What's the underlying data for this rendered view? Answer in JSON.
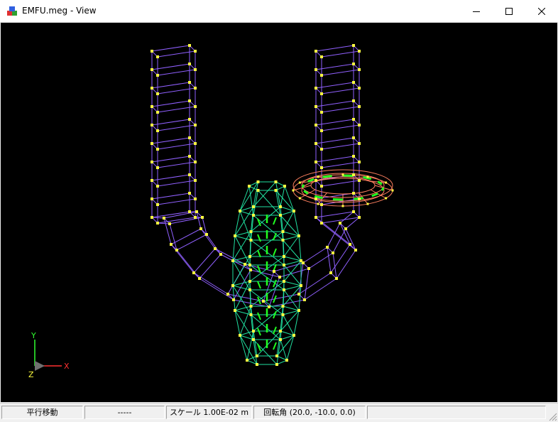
{
  "window": {
    "title": "EMFU.meg - View"
  },
  "axes": {
    "x": "X",
    "y": "Y",
    "z": "Z"
  },
  "colors": {
    "background": "#000000",
    "pipe_mesh": "#9060ff",
    "coil_mesh": "#20e0a0",
    "ring_mesh": "#ff8060",
    "nodes": "#ffff40",
    "arrows": "#20ff20",
    "axis_x": "#ff3030",
    "axis_y": "#30ff30",
    "axis_z": "#ffff40"
  },
  "statusbar": {
    "mode": "平行移動",
    "value": "-----",
    "scale": "スケール 1.00E-02 m",
    "rotation": "回転角 (20.0, -10.0, 0.0)"
  }
}
